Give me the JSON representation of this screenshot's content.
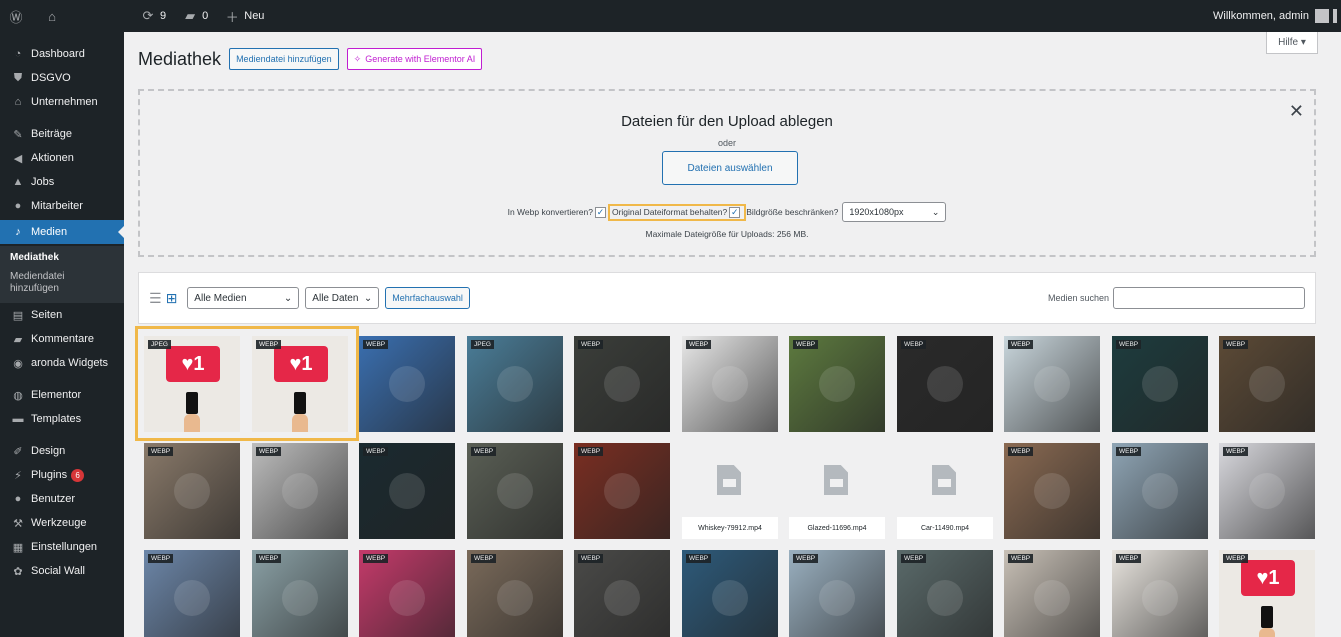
{
  "adminbar": {
    "updates_count": "9",
    "comments_count": "0",
    "new_label": "Neu",
    "greeting": "Willkommen, admin"
  },
  "sidebar": {
    "items": [
      {
        "label": "Dashboard",
        "icon": "dashboard-icon"
      },
      {
        "label": "DSGVO",
        "icon": "shield-icon"
      },
      {
        "label": "Unternehmen",
        "icon": "home-icon"
      },
      {
        "label": "Beiträge",
        "icon": "pin-icon"
      },
      {
        "label": "Aktionen",
        "icon": "megaphone-icon"
      },
      {
        "label": "Jobs",
        "icon": "bell-icon"
      },
      {
        "label": "Mitarbeiter",
        "icon": "user-icon"
      },
      {
        "label": "Medien",
        "icon": "media-icon"
      },
      {
        "label": "Seiten",
        "icon": "page-icon"
      },
      {
        "label": "Kommentare",
        "icon": "comment-icon"
      },
      {
        "label": "aronda Widgets",
        "icon": "widget-icon"
      },
      {
        "label": "Elementor",
        "icon": "elementor-icon"
      },
      {
        "label": "Templates",
        "icon": "folder-icon"
      },
      {
        "label": "Design",
        "icon": "brush-icon"
      },
      {
        "label": "Plugins",
        "icon": "plugin-icon"
      },
      {
        "label": "Benutzer",
        "icon": "users-icon"
      },
      {
        "label": "Werkzeuge",
        "icon": "wrench-icon"
      },
      {
        "label": "Einstellungen",
        "icon": "settings-icon"
      },
      {
        "label": "Social Wall",
        "icon": "social-icon"
      }
    ],
    "submenu": [
      "Mediathek",
      "Mediendatei hinzufügen"
    ],
    "plugins_badge": "6"
  },
  "header": {
    "title": "Mediathek",
    "add_button": "Mediendatei hinzufügen",
    "ai_button": "Generate with Elementor AI",
    "help": "Hilfe ▾"
  },
  "uploader": {
    "title": "Dateien für den Upload ablegen",
    "or": "oder",
    "select_button": "Dateien auswählen",
    "webp_label": "In Webp konvertieren?",
    "keep_format_label": "Original Dateiformat behalten?",
    "limit_label": "Bildgröße beschränken?",
    "size_value": "1920x1080px",
    "max_size": "Maximale Dateigröße für Uploads: 256 MB."
  },
  "toolbar": {
    "media_filter": "Alle Medien",
    "date_filter": "Alle Daten",
    "bulk_select": "Mehrfachauswahl",
    "search_label": "Medien suchen",
    "search_value": ""
  },
  "grid": {
    "row1": [
      {
        "tag": "JPEG",
        "kind": "heart"
      },
      {
        "tag": "WEBP",
        "kind": "heart"
      },
      {
        "tag": "WEBP",
        "color": "#3a6fb0"
      },
      {
        "tag": "JPEG",
        "color": "#4a7d98"
      },
      {
        "tag": "WEBP",
        "color": "#3b3e3a"
      },
      {
        "tag": "WEBP",
        "color": "#e8e8e8"
      },
      {
        "tag": "WEBP",
        "color": "#5d7a3f"
      },
      {
        "tag": "WEBP",
        "color": "#2a2a2a"
      },
      {
        "tag": "WEBP",
        "color": "#c9d6dc"
      },
      {
        "tag": "WEBP",
        "color": "#1d3c3e"
      },
      {
        "tag": "WEBP",
        "color": "#5c4a36"
      }
    ],
    "row2": [
      {
        "tag": "WEBP",
        "color": "#8a7a6a"
      },
      {
        "tag": "WEBP",
        "color": "#bdbdbd"
      },
      {
        "tag": "WEBP",
        "color": "#1a2a30"
      },
      {
        "tag": "WEBP",
        "color": "#5a5f55"
      },
      {
        "tag": "WEBP",
        "color": "#7a2e22"
      },
      {
        "tag": "",
        "kind": "video",
        "name": "Whiskey-79912.mp4"
      },
      {
        "tag": "",
        "kind": "video",
        "name": "Glazed-11696.mp4"
      },
      {
        "tag": "",
        "kind": "video",
        "name": "Car-11490.mp4"
      },
      {
        "tag": "WEBP",
        "color": "#8a6a52"
      },
      {
        "tag": "WEBP",
        "color": "#8fa5b5"
      },
      {
        "tag": "WEBP",
        "color": "#d9d9de"
      }
    ],
    "row3": [
      {
        "tag": "WEBP",
        "color": "#6c86a8"
      },
      {
        "tag": "WEBP",
        "color": "#8aa0a5"
      },
      {
        "tag": "WEBP",
        "color": "#c43a6a"
      },
      {
        "tag": "WEBP",
        "color": "#7a6a5a"
      },
      {
        "tag": "WEBP",
        "color": "#4a4a48"
      },
      {
        "tag": "WEBP",
        "color": "#2d5a7a"
      },
      {
        "tag": "WEBP",
        "color": "#9ab0c0"
      },
      {
        "tag": "WEBP",
        "color": "#5a6a6a"
      },
      {
        "tag": "WEBP",
        "color": "#c8c0b6"
      },
      {
        "tag": "WEBP",
        "color": "#e8e4de"
      },
      {
        "tag": "WEBP",
        "kind": "heart"
      }
    ]
  },
  "colors": {
    "accent": "#2271b1",
    "highlight": "#f0b849",
    "ai": "#c01ed1",
    "sidebar": "#1d2327"
  }
}
